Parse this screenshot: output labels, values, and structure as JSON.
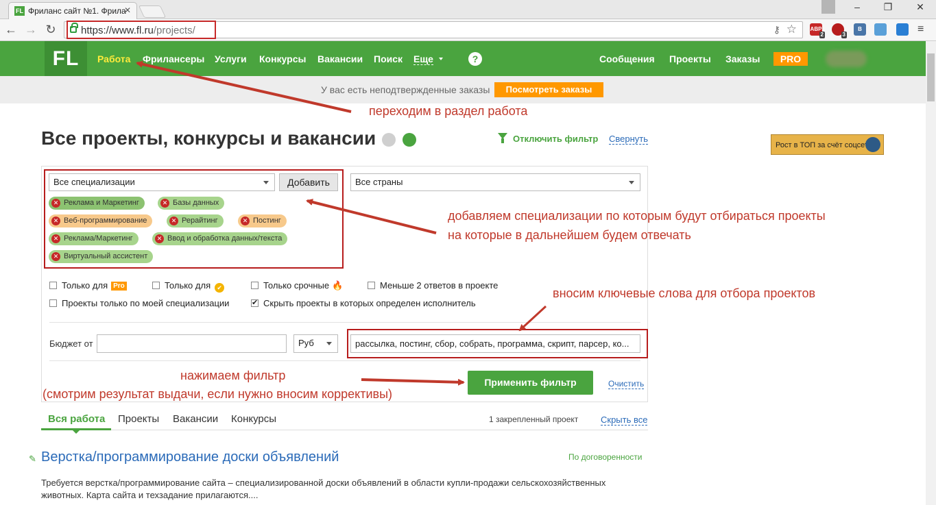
{
  "browser": {
    "tab_title": "Фриланс сайт №1. Фрила",
    "tab_favicon": "FL",
    "url_scheme": "https://www.fl.ru",
    "url_path": "/projects/",
    "extensions": [
      {
        "name": "adblock-icon",
        "label": "ABP",
        "badge": "2",
        "color": "#c62828"
      },
      {
        "name": "stop-icon",
        "label": "",
        "badge": "3",
        "color": "#b71c1c"
      },
      {
        "name": "vk-icon",
        "label": "B",
        "badge": "",
        "color": "#4a76a8"
      },
      {
        "name": "feather-icon",
        "label": "",
        "badge": "",
        "color": "#5aa0d8"
      },
      {
        "name": "check-ext-icon",
        "label": "",
        "badge": "",
        "color": "#2a7fd4"
      }
    ]
  },
  "site": {
    "logo": "FL",
    "nav": [
      "Работа",
      "Фрилансеры",
      "Услуги",
      "Конкурсы",
      "Вакансии",
      "Поиск",
      "Еще"
    ],
    "help": "?",
    "right_nav": [
      "Сообщения",
      "Проекты",
      "Заказы"
    ],
    "pro": "PRO",
    "notice_text": "У вас есть неподтвержденные заказы",
    "notice_button": "Посмотреть заказы"
  },
  "page": {
    "title": "Все проекты, конкурсы и вакансии",
    "disable_filter": "Отключить фильтр",
    "collapse": "Свернуть",
    "banner": "Рост в ТОП за счёт соцсетей"
  },
  "filter": {
    "spec_select": "Все специализации",
    "add_button": "Добавить",
    "country_select": "Все страны",
    "tags": [
      {
        "label": "Реклама и Маркетинг",
        "tone": "dg"
      },
      {
        "label": "Базы данных",
        "tone": "g"
      },
      {
        "label": "Веб-программирование",
        "tone": "o"
      },
      {
        "label": "Рерайтинг",
        "tone": "g"
      },
      {
        "label": "Постинг",
        "tone": "o"
      },
      {
        "label": "Реклама/Маркетинг",
        "tone": "g"
      },
      {
        "label": "Ввод и обработка данных/текста",
        "tone": "g"
      },
      {
        "label": "Виртуальный ассистент",
        "tone": "g"
      }
    ],
    "checks": {
      "only_for": "Только для",
      "pro_badge": "Pro",
      "only_for_verified": "Только для",
      "only_urgent": "Только срочные",
      "less_2": "Меньше 2 ответов в проекте",
      "my_spec": "Проекты только по моей специализации",
      "hide_assigned": "Скрыть проекты в которых определен исполнитель"
    },
    "budget_label": "Бюджет от",
    "budget_value": "",
    "currency": "Руб",
    "keywords": "рассылка, постинг, сбор, собрать, программа, скрипт, парсер, ко...",
    "apply": "Применить фильтр",
    "clear": "Очистить"
  },
  "results": {
    "tabs": [
      "Вся работа",
      "Проекты",
      "Вакансии",
      "Конкурсы"
    ],
    "pinned": "1 закрепленный проект",
    "hide_all": "Скрыть все",
    "project": {
      "title": "Верстка/программирование доски объявлений",
      "price": "По договоренности",
      "desc": "Требуется верстка/программирование сайта – специализированной доски объявлений в области купли-продажи сельскохозяйственных животных. Карта сайта и техзадание прилагаются...."
    }
  },
  "annotations": {
    "a1": "переходим в раздел работа",
    "a2_line1": "добавляем специализации по которым будут отбираться проекты",
    "a2_line2": "на которые в дальнейшем будем отвечать",
    "a3": "вносим ключевые слова для отбора проектов",
    "a4_line1": "нажимаем фильтр",
    "a4_line2": "(смотрим результат выдачи, если нужно вносим коррективы)"
  },
  "colors": {
    "brand_green": "#4aa43f",
    "accent_orange": "#ff9800",
    "annotation_red": "#c0392b",
    "link_blue": "#2a6ab8"
  }
}
